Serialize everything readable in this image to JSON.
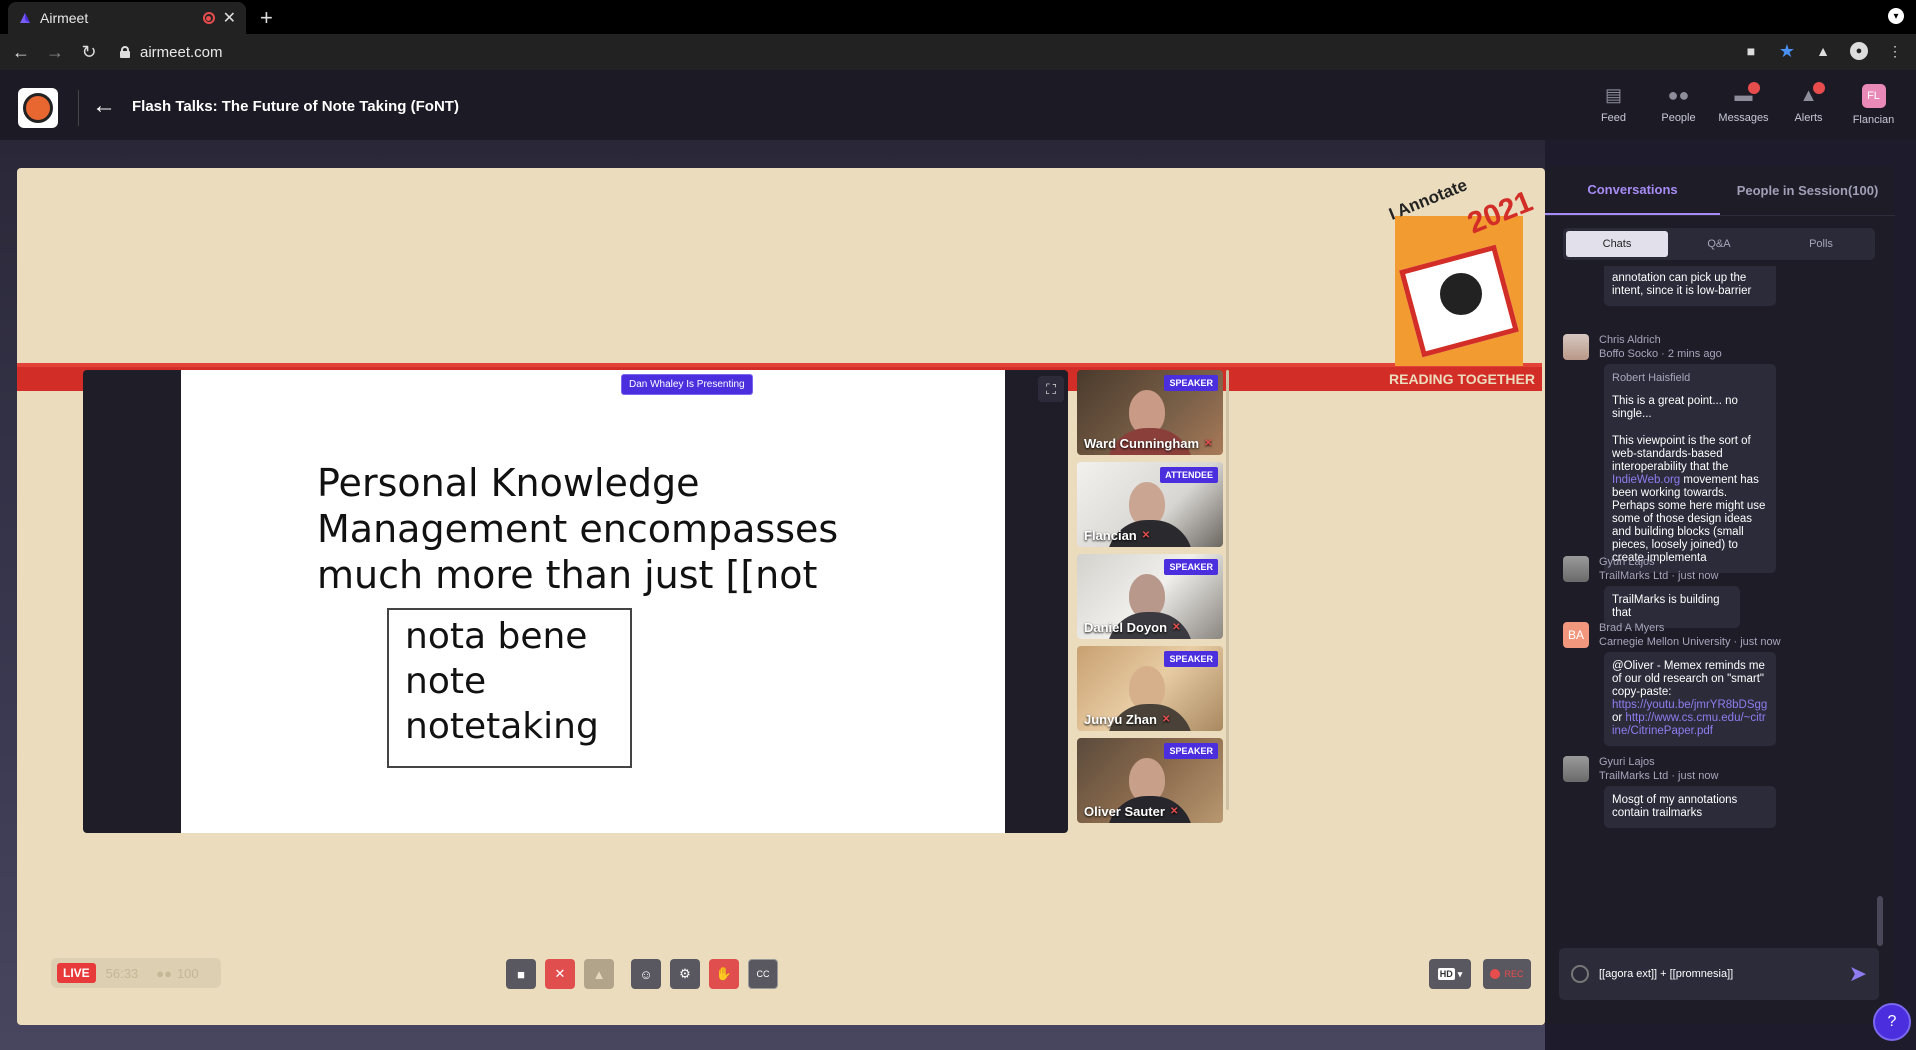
{
  "browser": {
    "tab_title": "Airmeet",
    "new_tab": "+",
    "url": "airmeet.com"
  },
  "header": {
    "back": "←",
    "title": "Flash Talks: The Future of Note Taking (FoNT)",
    "nav": [
      {
        "label": "Feed",
        "icon": "feed-icon"
      },
      {
        "label": "People",
        "icon": "people-icon"
      },
      {
        "label": "Messages",
        "icon": "messages-icon"
      },
      {
        "label": "Alerts",
        "icon": "alerts-icon"
      },
      {
        "label": "Flancian",
        "icon": "avatar"
      }
    ],
    "avatar_initials": "FL"
  },
  "event_logo": {
    "line1": "I Annotate",
    "line2": "2021",
    "bottom": "READING TOGETHER"
  },
  "stage": {
    "presenting": "Dan Whaley Is Presenting",
    "slide_heading": "Personal Knowledge Management encompasses much more than just [[not",
    "slide_box": [
      "nota bene",
      "note",
      "notetaking"
    ]
  },
  "speakers": [
    {
      "name": "Ward Cunningham",
      "role": "SPEAKER"
    },
    {
      "name": "Flancian",
      "role": "ATTENDEE"
    },
    {
      "name": "Daniel Doyon",
      "role": "SPEAKER"
    },
    {
      "name": "Junyu Zhan",
      "role": "SPEAKER"
    },
    {
      "name": "Oliver Sauter",
      "role": "SPEAKER"
    }
  ],
  "controls": {
    "live": "LIVE",
    "elapsed": "56:33",
    "attendees": "100",
    "hd": "HD",
    "rec": "REC",
    "cc": "CC"
  },
  "panel": {
    "tabs": [
      "Conversations",
      "People in Session(100)"
    ],
    "subtabs": [
      "Chats",
      "Q&A",
      "Polls"
    ],
    "messages": [
      {
        "text": "annotation can pick up the intent, since it is low-barrier"
      },
      {
        "name": "Chris Aldrich",
        "org": "Boffo Socko · 2 mins ago",
        "quote_name": "Robert Haisfield",
        "quote": "This is a great point... no single...",
        "text_before": "This viewpoint is the sort of web-standards-based interoperability that the ",
        "link": "IndieWeb.org",
        "text_after": " movement has been working towards. Perhaps some here might use some of those design ideas and building blocks (small pieces, loosely joined) to create implementa"
      },
      {
        "name": "Gyuri Lajos",
        "org": "TrailMarks Ltd · just now",
        "text": "TrailMarks is building that"
      },
      {
        "name": "Brad A Myers",
        "initials": "BA",
        "org": "Carnegie Mellon University · just now",
        "text": "@Oliver - Memex reminds me of our old research on \"smart\" copy-paste:",
        "link1": "https://youtu.be/jmrYR8bDSgg",
        "or": " or ",
        "link2": "http://www.cs.cmu.edu/~citrine/CitrinePaper.pdf"
      },
      {
        "name": "Gyuri Lajos",
        "org": "TrailMarks Ltd · just now",
        "text": "Mosgt of my annotations contain trailmarks"
      }
    ],
    "composer": "[[agora ext]] + [[promnesia]]"
  }
}
